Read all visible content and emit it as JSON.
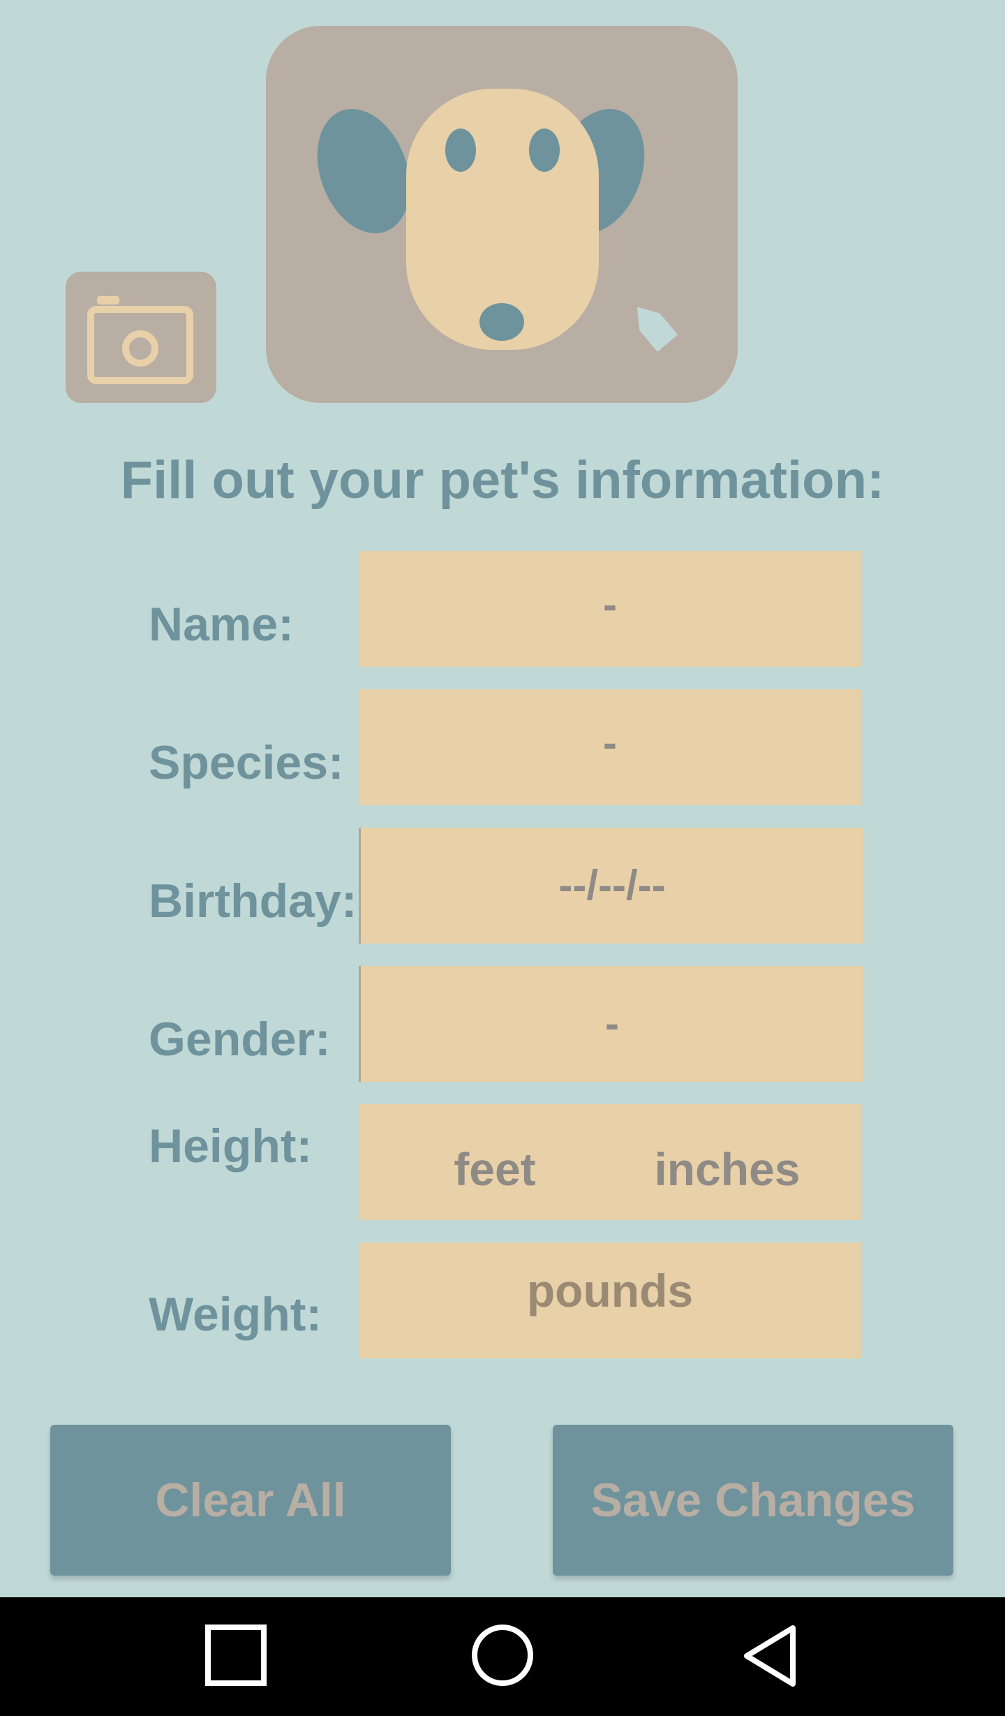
{
  "header": {
    "camera_icon": "camera-icon",
    "avatar_icon": "dog-face-icon",
    "edit_icon": "pencil-icon"
  },
  "form": {
    "title": "Fill out your pet's information:",
    "fields": {
      "name": {
        "label": "Name:",
        "value": "-"
      },
      "species": {
        "label": "Species:",
        "value": "-"
      },
      "birthday": {
        "label": "Birthday:",
        "value": "--/--/--"
      },
      "gender": {
        "label": "Gender:",
        "value": "-"
      },
      "height": {
        "label": "Height:",
        "feet_placeholder": "feet",
        "inches_placeholder": "inches"
      },
      "weight": {
        "label": "Weight:",
        "placeholder": "pounds"
      }
    }
  },
  "actions": {
    "clear_label": "Clear All",
    "save_label": "Save Changes"
  },
  "navbar": {
    "recents_icon": "square-icon",
    "home_icon": "circle-icon",
    "back_icon": "triangle-back-icon"
  },
  "colors": {
    "background": "#c0d9d6",
    "accent": "#6f939d",
    "field_bg": "#e8d0a8",
    "tile_bg": "#b8aea4",
    "button_bg": "#6e939c"
  }
}
